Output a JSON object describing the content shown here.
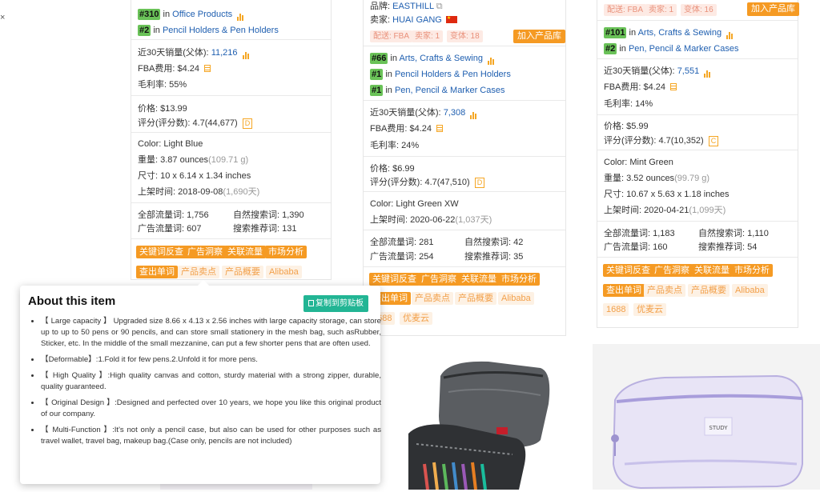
{
  "left_card": {
    "ranks": [
      {
        "rank": "#310",
        "prefix": "in",
        "category": "Office Products"
      },
      {
        "rank": "#2",
        "prefix": "in",
        "category": "Pencil Holders & Pen Holders"
      }
    ],
    "sales_label": "近30天销量(父体):",
    "sales_value": "11,216",
    "fba_label": "FBA费用:",
    "fba_value": "$4.24",
    "margin_label": "毛利率:",
    "margin_value": "55%",
    "price_label": "价格:",
    "price_value": "$13.99",
    "rating_label": "评分(评分数):",
    "rating_value": "4.7(44,677)",
    "rating_grade": "D",
    "color": "Color: Light Blue",
    "weight_label": "重量:",
    "weight_value": "3.87 ounces",
    "weight_alt": "(109.71 g)",
    "size_label": "尺寸:",
    "size_value": "10 x 6.14 x 1.34 inches",
    "date_label": "上架时间:",
    "date_value": "2018-09-08",
    "date_days": "(1,690天)",
    "traffic_all_label": "全部流量词:",
    "traffic_all": "1,756",
    "traffic_natural_label": "自然搜索词:",
    "traffic_natural": "1,390",
    "traffic_ad_label": "广告流量词:",
    "traffic_ad": "607",
    "traffic_rec_label": "搜索推荐词:",
    "traffic_rec": "131",
    "tags": [
      "关键词反查",
      "广告洞察",
      "关联流量",
      "市场分析",
      "查出单词"
    ],
    "tags_light": [
      "产品卖点",
      "产品概要",
      "Alibaba"
    ]
  },
  "middle_card": {
    "brand_label": "品牌:",
    "brand_value": "EASTHILL",
    "seller_label": "卖家:",
    "seller_value": "HUAI GANG",
    "pills": [
      "配送: FBA",
      "卖家: 1",
      "变体: 18"
    ],
    "add_button": "加入产品库",
    "ranks": [
      {
        "rank": "#66",
        "prefix": "in",
        "category": "Arts, Crafts & Sewing"
      },
      {
        "rank": "#1",
        "prefix": "in",
        "category": "Pencil Holders & Pen Holders"
      },
      {
        "rank": "#1",
        "prefix": "in",
        "category": "Pen, Pencil & Marker Cases"
      }
    ],
    "sales_label": "近30天销量(父体):",
    "sales_value": "7,308",
    "fba_label": "FBA费用:",
    "fba_value": "$4.24",
    "margin_label": "毛利率:",
    "margin_value": "24%",
    "price_label": "价格:",
    "price_value": "$6.99",
    "rating_label": "评分(评分数):",
    "rating_value": "4.7(47,510)",
    "rating_grade": "D",
    "color": "Color: Light Green XW",
    "date_label": "上架时间:",
    "date_value": "2020-06-22",
    "date_days": "(1,037天)",
    "traffic_all_label": "全部流量词:",
    "traffic_all": "281",
    "traffic_natural_label": "自然搜索词:",
    "traffic_natural": "42",
    "traffic_ad_label": "广告流量词:",
    "traffic_ad": "254",
    "traffic_rec_label": "搜索推荐词:",
    "traffic_rec": "35",
    "tags": [
      "关键词反查",
      "广告洞察",
      "关联流量",
      "市场分析",
      "查出单词"
    ],
    "tags_light": [
      "产品卖点",
      "产品概要",
      "Alibaba",
      "1688",
      "优麦云"
    ]
  },
  "right_card": {
    "pills": [
      "配送: FBA",
      "卖家: 1",
      "变体: 16"
    ],
    "add_button": "加入产品库",
    "ranks": [
      {
        "rank": "#101",
        "prefix": "in",
        "category": "Arts, Crafts & Sewing"
      },
      {
        "rank": "#2",
        "prefix": "in",
        "category": "Pen, Pencil & Marker Cases"
      }
    ],
    "sales_label": "近30天销量(父体):",
    "sales_value": "7,551",
    "fba_label": "FBA费用:",
    "fba_value": "$4.24",
    "margin_label": "毛利率:",
    "margin_value": "14%",
    "price_label": "价格:",
    "price_value": "$5.99",
    "rating_label": "评分(评分数):",
    "rating_value": "4.7(10,352)",
    "rating_grade": "C",
    "color": "Color: Mint Green",
    "weight_label": "重量:",
    "weight_value": "3.52 ounces",
    "weight_alt": "(99.79 g)",
    "size_label": "尺寸:",
    "size_value": "10.67 x 5.63 x 1.18 inches",
    "date_label": "上架时间:",
    "date_value": "2020-04-21",
    "date_days": "(1,099天)",
    "traffic_all_label": "全部流量词:",
    "traffic_all": "1,183",
    "traffic_natural_label": "自然搜索词:",
    "traffic_natural": "1,110",
    "traffic_ad_label": "广告流量词:",
    "traffic_ad": "160",
    "traffic_rec_label": "搜索推荐词:",
    "traffic_rec": "54",
    "tags": [
      "关键词反查",
      "广告洞察",
      "关联流量",
      "市场分析",
      "查出单词"
    ],
    "tags_light": [
      "产品卖点",
      "产品概要",
      "Alibaba",
      "1688",
      "优麦云"
    ]
  },
  "popup": {
    "title": "About this item",
    "copy_button": "复制到剪贴板",
    "bullets": [
      "【 Large capacity 】 Upgraded size 8.66 x 4.13 x 2.56 inches with large capacity storage, can store up to up to 50 pens or 90 pencils, and can store small stationery in the mesh bag, such asRubber, Sticker, etc. In the middle of the small mezzanine, can put a few shorter pens that are often used.",
      "【Deformable】:1.Fold it for few pens.2.Unfold it for more pens.",
      "【 High Quality 】:High quality canvas and cotton, sturdy material with a strong zipper, durable, quality guaranteed.",
      "【 Original Design 】:Designed and perfected over 10 years, we hope you like this original product of our company.",
      "【 Multi-Function 】:It's not only a pencil case, but also can be used for other purposes such as travel wallet, travel bag, makeup bag.(Case only, pencils are not included)"
    ]
  },
  "photos": {
    "middle_label": "STUDY"
  },
  "colors": {
    "accent_orange": "#f59a23",
    "rank_green": "#6ac258",
    "link_blue": "#1f5fb0",
    "copy_green": "#22b594"
  }
}
